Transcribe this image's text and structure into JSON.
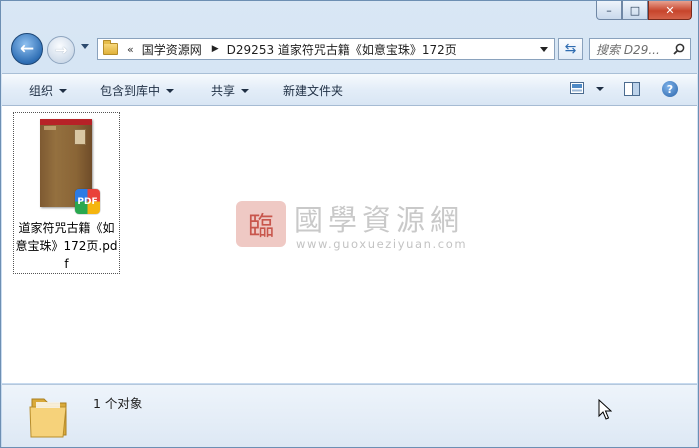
{
  "window": {
    "caption_buttons": {
      "minimize": "–",
      "maximize": "□",
      "close": "✕"
    }
  },
  "navigation": {
    "back_icon": "back-arrow-icon",
    "forward_icon": "forward-arrow-icon",
    "address": {
      "overflow": "«",
      "crumbs": [
        "国学资源网",
        "D29253 道家符咒古籍《如意宝珠》172页"
      ]
    },
    "search_placeholder": "搜索 D29...",
    "refresh_icon": "refresh-icon"
  },
  "toolbar": {
    "organize": "组织",
    "include_in_library": "包含到库中",
    "share": "共享",
    "new_folder": "新建文件夹",
    "help": "?"
  },
  "files": [
    {
      "name": "道家符咒古籍《如意宝珠》172页.pdf",
      "badge": "PDF",
      "thumb_tag": "PDF"
    }
  ],
  "watermark": {
    "logo_glyph": "臨",
    "title": "國學資源網",
    "url": "www.guoxueziyuan.com"
  },
  "status": {
    "count": "1 个对象"
  },
  "colors": {
    "accent": "#2f6fb5",
    "close": "#c7452c",
    "thumb_red": "#b72227"
  }
}
